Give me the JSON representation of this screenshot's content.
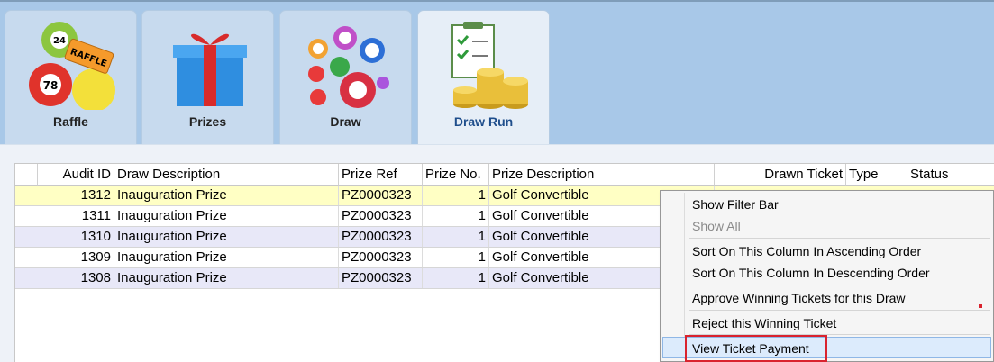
{
  "tabs": [
    {
      "label": "Raffle",
      "icon": "raffle-balls-icon"
    },
    {
      "label": "Prizes",
      "icon": "gift-box-icon"
    },
    {
      "label": "Draw",
      "icon": "lottery-balls-icon"
    },
    {
      "label": "Draw Run",
      "icon": "checklist-coins-icon"
    }
  ],
  "grid": {
    "headers": {
      "audit_id": "Audit ID",
      "draw_description": "Draw Description",
      "prize_ref": "Prize Ref",
      "prize_no": "Prize No.",
      "prize_description": "Prize Description",
      "drawn_ticket": "Drawn Ticket",
      "type": "Type",
      "status": "Status"
    },
    "rows": [
      {
        "audit_id": "1312",
        "draw_description": "Inauguration Prize",
        "prize_ref": "PZ0000323",
        "prize_no": "1",
        "prize_description": "Golf Convertible"
      },
      {
        "audit_id": "1311",
        "draw_description": "Inauguration Prize",
        "prize_ref": "PZ0000323",
        "prize_no": "1",
        "prize_description": "Golf Convertible"
      },
      {
        "audit_id": "1310",
        "draw_description": "Inauguration Prize",
        "prize_ref": "PZ0000323",
        "prize_no": "1",
        "prize_description": "Golf Convertible"
      },
      {
        "audit_id": "1309",
        "draw_description": "Inauguration Prize",
        "prize_ref": "PZ0000323",
        "prize_no": "1",
        "prize_description": "Golf Convertible"
      },
      {
        "audit_id": "1308",
        "draw_description": "Inauguration Prize",
        "prize_ref": "PZ0000323",
        "prize_no": "1",
        "prize_description": "Golf Convertible"
      }
    ]
  },
  "context_menu": {
    "show_filter_bar": "Show Filter Bar",
    "show_all": "Show All",
    "sort_asc": "Sort On This Column In Ascending Order",
    "sort_desc": "Sort On This Column In Descending Order",
    "approve": "Approve Winning Tickets for this Draw",
    "reject": "Reject this Winning Ticket",
    "view_payment": "View Ticket Payment"
  },
  "colors": {
    "ribbon_bg": "#a8c8e8",
    "selected_row": "#ffffc4",
    "alt_row": "#e8e8f8",
    "highlight_box": "#d9232e",
    "active_tab_text": "#1f4e8c"
  }
}
